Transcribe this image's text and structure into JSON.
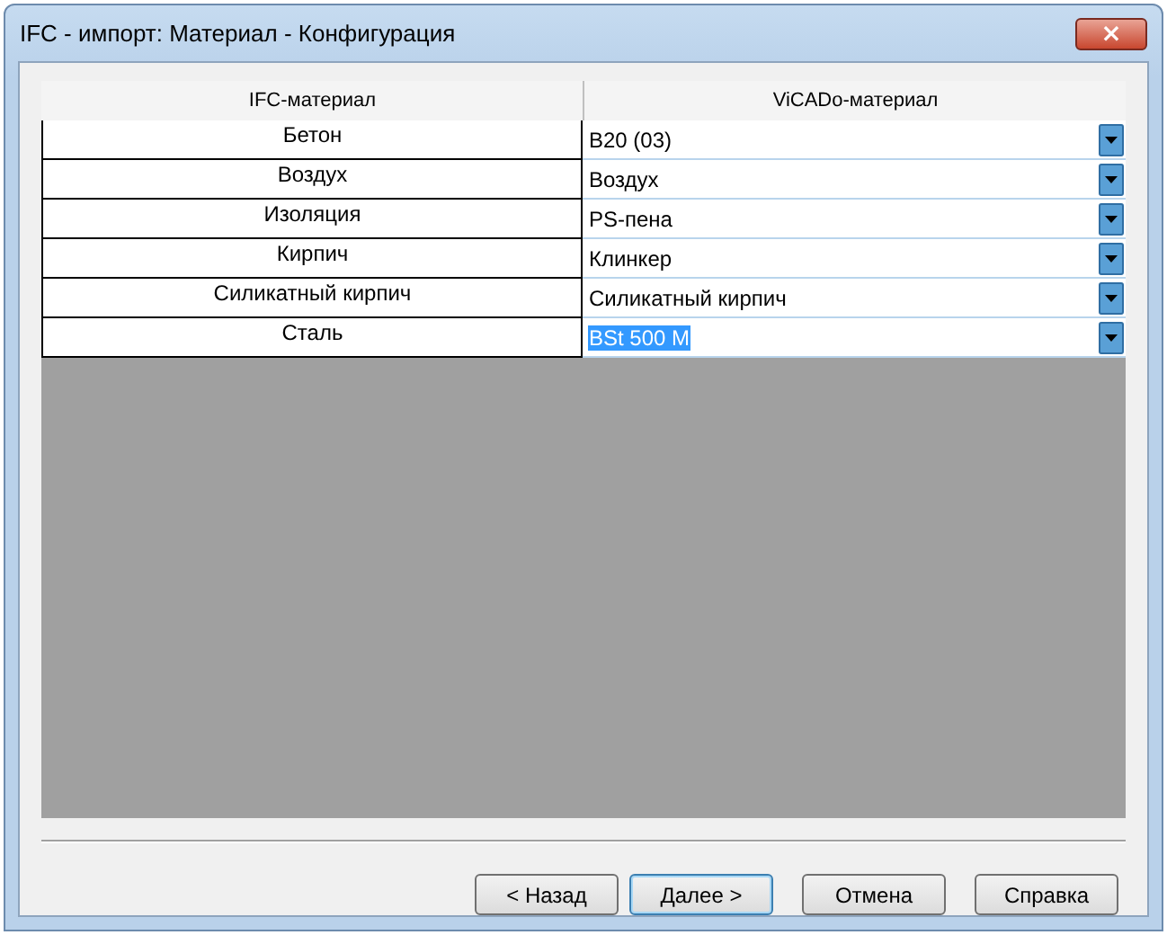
{
  "window": {
    "title": "IFC - импорт: Материал - Конфигурация",
    "close": "×"
  },
  "table": {
    "columns": [
      "IFC-материал",
      "ViCADo-материал"
    ],
    "rows": [
      {
        "ifc": "Бетон",
        "vicado": "B20 (03)",
        "selected": false
      },
      {
        "ifc": "Воздух",
        "vicado": "Воздух",
        "selected": false
      },
      {
        "ifc": "Изоляция",
        "vicado": "PS-пена",
        "selected": false
      },
      {
        "ifc": "Кирпич",
        "vicado": "Клинкер",
        "selected": false
      },
      {
        "ifc": "Силикатный кирпич",
        "vicado": "Силикатный кирпич",
        "selected": false
      },
      {
        "ifc": "Сталь",
        "vicado": "BSt 500 M",
        "selected": true
      }
    ]
  },
  "buttons": [
    {
      "label": "< Назад",
      "default": false
    },
    {
      "label": "Далее >",
      "default": true
    },
    {
      "label": "Отмена",
      "default": false
    },
    {
      "label": "Справка",
      "default": false
    }
  ]
}
